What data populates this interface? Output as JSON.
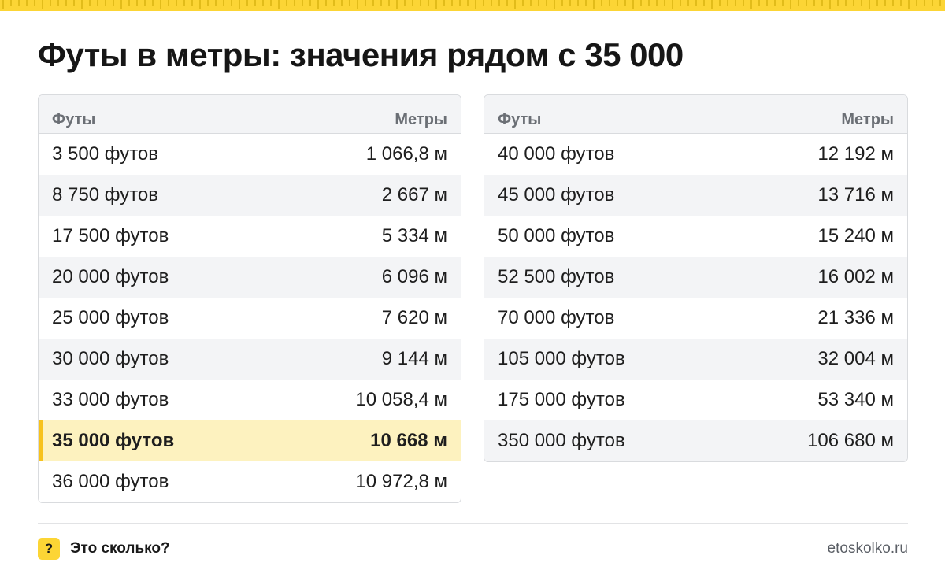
{
  "title": "Футы в метры: значения рядом с 35 000",
  "colors": {
    "accent": "#fcd535",
    "highlight_row": "#fdf2bf",
    "header_bg": "#f3f4f6"
  },
  "left_table": {
    "header": {
      "col1": "Футы",
      "col2": "Метры"
    },
    "rows": [
      {
        "feet": "3 500 футов",
        "meters": "1 066,8 м"
      },
      {
        "feet": "8 750 футов",
        "meters": "2 667 м"
      },
      {
        "feet": "17 500 футов",
        "meters": "5 334 м"
      },
      {
        "feet": "20 000 футов",
        "meters": "6 096 м"
      },
      {
        "feet": "25 000 футов",
        "meters": "7 620 м"
      },
      {
        "feet": "30 000 футов",
        "meters": "9 144 м"
      },
      {
        "feet": "33 000 футов",
        "meters": "10 058,4 м"
      },
      {
        "feet": "35 000 футов",
        "meters": "10 668 м",
        "highlighted": true
      },
      {
        "feet": "36 000 футов",
        "meters": "10 972,8 м"
      }
    ]
  },
  "right_table": {
    "header": {
      "col1": "Футы",
      "col2": "Метры"
    },
    "rows": [
      {
        "feet": "40 000 футов",
        "meters": "12 192 м"
      },
      {
        "feet": "45 000 футов",
        "meters": "13 716 м"
      },
      {
        "feet": "50 000 футов",
        "meters": "15 240 м"
      },
      {
        "feet": "52 500 футов",
        "meters": "16 002 м"
      },
      {
        "feet": "70 000 футов",
        "meters": "21 336 м"
      },
      {
        "feet": "105 000 футов",
        "meters": "32 004 м"
      },
      {
        "feet": "175 000 футов",
        "meters": "53 340 м"
      },
      {
        "feet": "350 000 футов",
        "meters": "106 680 м"
      }
    ]
  },
  "footer": {
    "logo_icon": "?",
    "logo_text": "Это сколько?",
    "site": "etoskolko.ru"
  }
}
